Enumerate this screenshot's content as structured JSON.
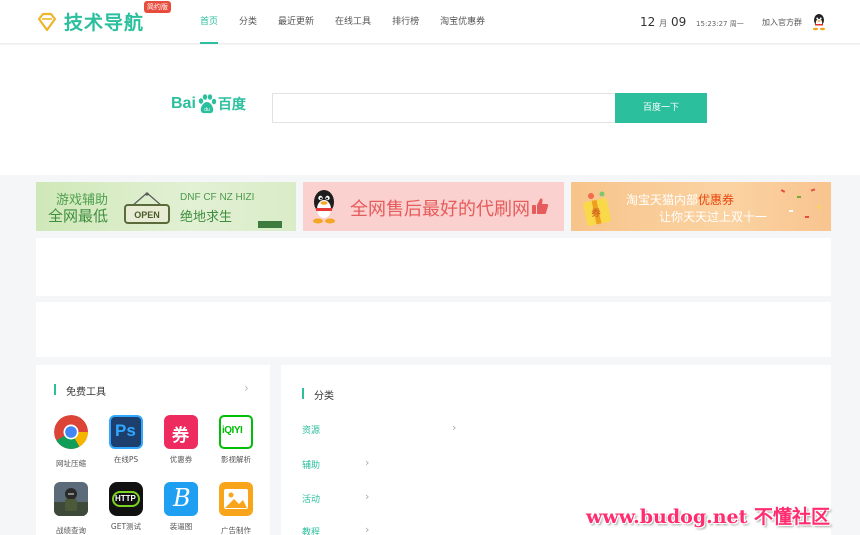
{
  "header": {
    "logo_text": "技术导航",
    "logo_badge": "简约版",
    "nav": [
      "首页",
      "分类",
      "最近更新",
      "在线工具",
      "排行榜",
      "淘宝优惠券"
    ],
    "date_month": "12",
    "date_month_unit": "月",
    "date_day": "09",
    "time": "15:23:27 周一",
    "join": "加入官方群",
    "accent": "#2bbf9e"
  },
  "search": {
    "engine_bai": "Bai",
    "engine_du": "百度",
    "button": "百度一下",
    "value": ""
  },
  "banners": {
    "b1": {
      "line1": "游戏辅助",
      "line2": "全网最低",
      "sign": "OPEN",
      "line3": "DNF CF NZ HIZI",
      "line4": "绝地求生"
    },
    "b2": {
      "text": "全网售后最好的代刷网"
    },
    "b3": {
      "line1_a": "淘宝天猫内部",
      "line1_b": "优惠券",
      "line2": "让你天天过上双十一"
    }
  },
  "tools": {
    "title": "免费工具",
    "items": [
      {
        "label": "网址压缩",
        "icon": "chrome-icon"
      },
      {
        "label": "在线PS",
        "icon": "photoshop-icon"
      },
      {
        "label": "优惠券",
        "icon": "coupon-icon"
      },
      {
        "label": "影视解析",
        "icon": "iqiyi-icon"
      },
      {
        "label": "战绩查询",
        "icon": "pubg-icon"
      },
      {
        "label": "GET测试",
        "icon": "http-icon"
      },
      {
        "label": "装逼图",
        "icon": "b-letter-icon"
      },
      {
        "label": "广告制作",
        "icon": "image-icon"
      }
    ],
    "icon_texts": {
      "ps": "Ps",
      "coupon": "券",
      "iqiyi": "iQIYI",
      "http": "HTTP",
      "b": "B"
    }
  },
  "categories": {
    "title": "分类",
    "items": [
      "资源",
      "辅助",
      "活动",
      "教程"
    ]
  },
  "watermark": "www.budog.net 不懂社区"
}
